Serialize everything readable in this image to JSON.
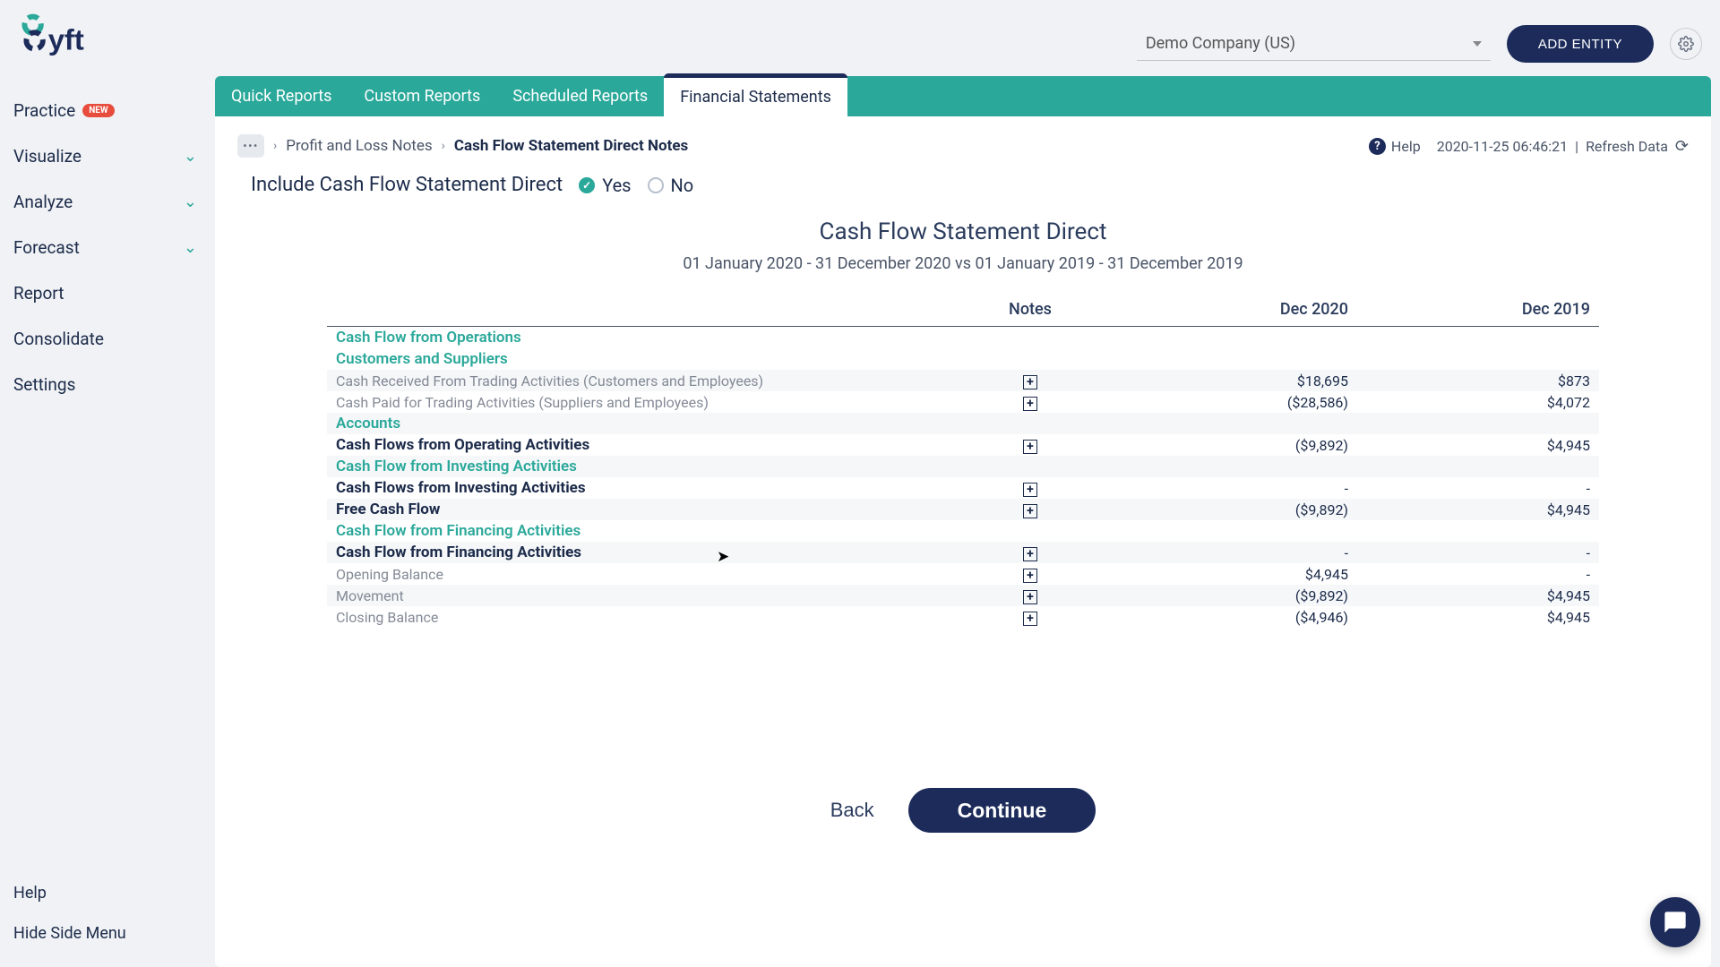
{
  "header": {
    "company_select": "Demo Company (US)",
    "add_entity": "ADD ENTITY"
  },
  "sidebar": {
    "items": [
      {
        "label": "Practice",
        "badge": "NEW",
        "chevron": false
      },
      {
        "label": "Visualize",
        "chevron": true
      },
      {
        "label": "Analyze",
        "chevron": true
      },
      {
        "label": "Forecast",
        "chevron": true
      },
      {
        "label": "Report",
        "chevron": false
      },
      {
        "label": "Consolidate",
        "chevron": false
      },
      {
        "label": "Settings",
        "chevron": false
      }
    ],
    "bottom": {
      "help": "Help",
      "hide": "Hide Side Menu"
    }
  },
  "tabs": [
    {
      "label": "Quick Reports"
    },
    {
      "label": "Custom Reports"
    },
    {
      "label": "Scheduled Reports"
    },
    {
      "label": "Financial Statements",
      "active": true
    }
  ],
  "breadcrumb": {
    "prev": "Profit and Loss Notes",
    "current": "Cash Flow Statement Direct Notes"
  },
  "toolbar": {
    "help": "Help",
    "timestamp": "2020-11-25 06:46:21",
    "refresh": "Refresh Data"
  },
  "include": {
    "label": "Include Cash Flow Statement Direct",
    "yes": "Yes",
    "no": "No",
    "selected": "yes"
  },
  "report": {
    "title": "Cash Flow Statement Direct",
    "range": "01 January 2020 - 31 December 2020 vs 01 January 2019 - 31 December 2019",
    "columns": {
      "notes": "Notes",
      "c1": "Dec 2020",
      "c2": "Dec 2019"
    },
    "rows": [
      {
        "type": "section",
        "label": "Cash Flow from Operations"
      },
      {
        "type": "section",
        "label": "Customers and Suppliers"
      },
      {
        "type": "data",
        "label": "Cash Received From Trading Activities (Customers and Employees)",
        "note": true,
        "v1": "$18,695",
        "v2": "$873",
        "stripe": true,
        "muted": true
      },
      {
        "type": "data",
        "label": "Cash Paid for Trading Activities (Suppliers and Employees)",
        "note": true,
        "v1": "($28,586)",
        "v2": "$4,072",
        "muted": true
      },
      {
        "type": "section",
        "label": "Accounts",
        "stripe": true
      },
      {
        "type": "bold",
        "label": "Cash Flows from Operating Activities",
        "note": true,
        "v1": "($9,892)",
        "v2": "$4,945"
      },
      {
        "type": "section",
        "label": "Cash Flow from Investing Activities",
        "stripe": true
      },
      {
        "type": "bold",
        "label": "Cash Flows from Investing Activities",
        "note": true,
        "v1": "-",
        "v2": "-"
      },
      {
        "type": "bold",
        "label": "Free Cash Flow",
        "note": true,
        "v1": "($9,892)",
        "v2": "$4,945",
        "stripe": true
      },
      {
        "type": "section",
        "label": "Cash Flow from Financing Activities"
      },
      {
        "type": "bold",
        "label": "Cash Flow from Financing Activities",
        "note": true,
        "v1": "-",
        "v2": "-",
        "stripe": true
      },
      {
        "type": "data",
        "label": "Opening Balance",
        "note": true,
        "v1": "$4,945",
        "v2": "-",
        "muted": true
      },
      {
        "type": "data",
        "label": "Movement",
        "note": true,
        "v1": "($9,892)",
        "v2": "$4,945",
        "stripe": true,
        "muted": true
      },
      {
        "type": "data",
        "label": "Closing Balance",
        "note": true,
        "v1": "($4,946)",
        "v2": "$4,945",
        "muted": true
      }
    ]
  },
  "buttons": {
    "back": "Back",
    "continue": "Continue"
  }
}
